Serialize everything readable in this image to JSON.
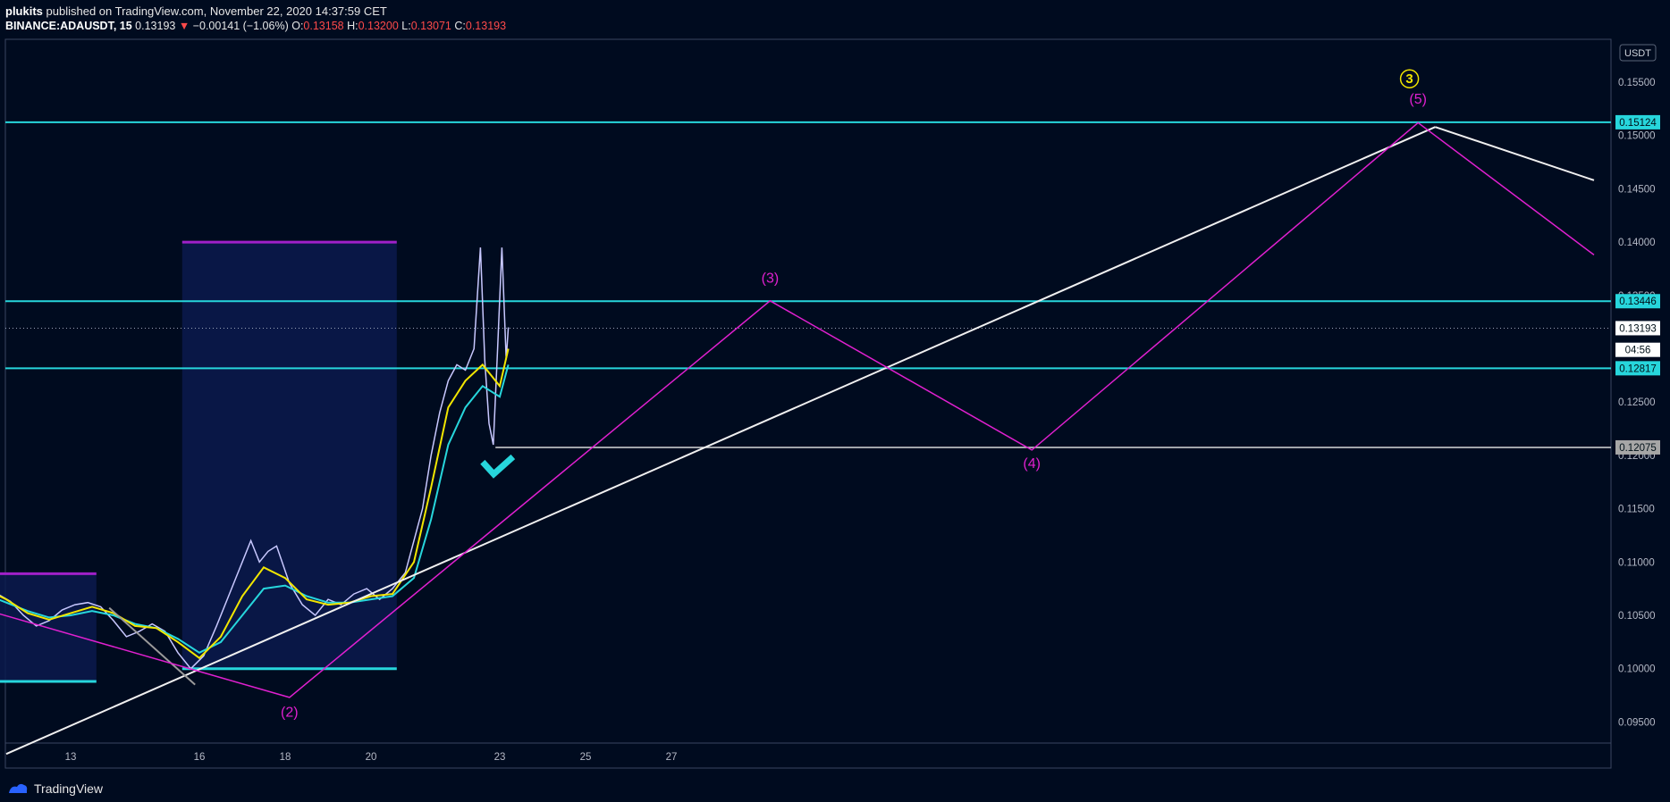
{
  "header": {
    "author": "plukits",
    "published": " published on TradingView.com, November 22, 2020 14:37:59 CET",
    "symbol": "BINANCE:ADAUSDT, 15",
    "last": "0.13193",
    "arrow": "▼",
    "change": "−0.00141 (−1.06%)",
    "o_label": "O:",
    "o_val": "0.13158",
    "h_label": "H:",
    "h_val": "0.13200",
    "l_label": "L:",
    "l_val": "0.13071",
    "c_label": "C:",
    "c_val": "0.13193"
  },
  "footer": {
    "brand": "TradingView"
  },
  "colors": {
    "background": "#000b1f",
    "cyan": "#27d6dc",
    "magenta": "#e020d0",
    "purple": "#a020c8",
    "white": "#f0f0f0",
    "yellow": "#f2e600",
    "candle": "#c8c8ff",
    "box": "#0a1a4d"
  },
  "chart_data": {
    "type": "line",
    "currency_label": "USDT",
    "x_ticks": [
      "13",
      "16",
      "18",
      "20",
      "23",
      "25",
      "27"
    ],
    "y_ticks": [
      "0.15500",
      "0.15000",
      "0.14500",
      "0.14000",
      "0.13500",
      "0.13000",
      "0.12500",
      "0.12000",
      "0.11500",
      "0.11000",
      "0.10500",
      "0.10000",
      "0.09500"
    ],
    "ylim": [
      0.0925,
      0.1588
    ],
    "price_labels": [
      {
        "text": "0.15124",
        "value": 0.15124,
        "style": "cyan"
      },
      {
        "text": "0.13446",
        "value": 0.13446,
        "style": "cyan"
      },
      {
        "text": "0.13193",
        "value": 0.13193,
        "style": "white"
      },
      {
        "text": "04:56",
        "value": 0.1299,
        "style": "white"
      },
      {
        "text": "0.12817",
        "value": 0.12817,
        "style": "cyan"
      },
      {
        "text": "0.12075",
        "value": 0.12075,
        "style": "gray"
      }
    ],
    "horizontal_levels": [
      {
        "value": 0.15124,
        "color": "cyan"
      },
      {
        "value": 0.13446,
        "color": "cyan"
      },
      {
        "value": 0.12817,
        "color": "cyan"
      },
      {
        "value": 0.13193,
        "color": "dotted"
      }
    ],
    "wave_path": [
      {
        "x": 9.3,
        "y": 0.1075
      },
      {
        "x": 18.1,
        "y": 0.0973
      },
      {
        "x": 29.3,
        "y": 0.1345
      },
      {
        "x": 35.4,
        "y": 0.1205
      },
      {
        "x": 44.4,
        "y": 0.1512
      },
      {
        "x": 48.5,
        "y": 0.1388
      }
    ],
    "wave_labels": [
      {
        "text": "(2)",
        "x": 18.1,
        "y": 0.0955
      },
      {
        "text": "(3)",
        "x": 29.3,
        "y": 0.1362
      },
      {
        "text": "(4)",
        "x": 35.4,
        "y": 0.1188
      },
      {
        "text": "(5)",
        "x": 44.4,
        "y": 0.153
      }
    ],
    "major_label": {
      "text": "3",
      "x": 44.2,
      "y": 0.1549
    },
    "trend_line": [
      {
        "x": 11.5,
        "y": 0.092
      },
      {
        "x": 44.8,
        "y": 0.1508
      }
    ],
    "trend_line_down": [
      {
        "x": 44.8,
        "y": 0.1508
      },
      {
        "x": 48.5,
        "y": 0.1458
      }
    ],
    "small_gray_line": [
      {
        "x": 13.9,
        "y": 0.1057
      },
      {
        "x": 15.9,
        "y": 0.0985
      }
    ],
    "support_line": {
      "value": 0.12075,
      "x_start": 22.9
    },
    "boxes": [
      {
        "x1": 11.0,
        "x2": 13.6,
        "top": 0.1089,
        "bottom": 0.0988
      },
      {
        "x1": 15.6,
        "x2": 20.6,
        "top": 0.14,
        "bottom": 0.1
      }
    ],
    "checkmark": {
      "x": 22.9,
      "y": 0.1185
    },
    "price": [
      [
        11.0,
        0.1085
      ],
      [
        11.3,
        0.107
      ],
      [
        11.6,
        0.1063
      ],
      [
        11.9,
        0.105
      ],
      [
        12.2,
        0.104
      ],
      [
        12.5,
        0.1045
      ],
      [
        12.8,
        0.1055
      ],
      [
        13.1,
        0.106
      ],
      [
        13.4,
        0.1062
      ],
      [
        13.7,
        0.1058
      ],
      [
        14.0,
        0.1045
      ],
      [
        14.3,
        0.103
      ],
      [
        14.6,
        0.1035
      ],
      [
        14.9,
        0.1042
      ],
      [
        15.2,
        0.1035
      ],
      [
        15.5,
        0.1015
      ],
      [
        15.8,
        0.1
      ],
      [
        16.1,
        0.1012
      ],
      [
        16.4,
        0.104
      ],
      [
        16.7,
        0.107
      ],
      [
        17.0,
        0.11
      ],
      [
        17.2,
        0.112
      ],
      [
        17.4,
        0.11
      ],
      [
        17.6,
        0.111
      ],
      [
        17.8,
        0.1115
      ],
      [
        18.1,
        0.108
      ],
      [
        18.4,
        0.106
      ],
      [
        18.7,
        0.105
      ],
      [
        19.0,
        0.1065
      ],
      [
        19.3,
        0.106
      ],
      [
        19.6,
        0.107
      ],
      [
        19.9,
        0.1075
      ],
      [
        20.2,
        0.1065
      ],
      [
        20.5,
        0.1075
      ],
      [
        20.8,
        0.109
      ],
      [
        21.0,
        0.112
      ],
      [
        21.2,
        0.115
      ],
      [
        21.4,
        0.12
      ],
      [
        21.6,
        0.124
      ],
      [
        21.8,
        0.127
      ],
      [
        22.0,
        0.1285
      ],
      [
        22.2,
        0.128
      ],
      [
        22.4,
        0.13
      ],
      [
        22.55,
        0.1395
      ],
      [
        22.65,
        0.129
      ],
      [
        22.75,
        0.123
      ],
      [
        22.85,
        0.121
      ],
      [
        22.95,
        0.13
      ],
      [
        23.05,
        0.1395
      ],
      [
        23.15,
        0.129
      ],
      [
        23.2,
        0.132
      ]
    ],
    "ema_yellow": [
      [
        11.0,
        0.1075
      ],
      [
        11.5,
        0.1065
      ],
      [
        12.0,
        0.1052
      ],
      [
        12.5,
        0.1046
      ],
      [
        13.0,
        0.1052
      ],
      [
        13.5,
        0.1058
      ],
      [
        14.0,
        0.1052
      ],
      [
        14.5,
        0.104
      ],
      [
        15.0,
        0.1038
      ],
      [
        15.5,
        0.1025
      ],
      [
        16.0,
        0.101
      ],
      [
        16.5,
        0.103
      ],
      [
        17.0,
        0.1068
      ],
      [
        17.5,
        0.1095
      ],
      [
        18.0,
        0.1085
      ],
      [
        18.5,
        0.1065
      ],
      [
        19.0,
        0.106
      ],
      [
        19.5,
        0.1062
      ],
      [
        20.0,
        0.1068
      ],
      [
        20.5,
        0.107
      ],
      [
        21.0,
        0.11
      ],
      [
        21.4,
        0.117
      ],
      [
        21.8,
        0.1245
      ],
      [
        22.2,
        0.127
      ],
      [
        22.6,
        0.1285
      ],
      [
        23.0,
        0.1265
      ],
      [
        23.2,
        0.13
      ]
    ],
    "ema_cyan": [
      [
        11.0,
        0.107
      ],
      [
        11.5,
        0.1062
      ],
      [
        12.0,
        0.1054
      ],
      [
        12.5,
        0.1048
      ],
      [
        13.0,
        0.105
      ],
      [
        13.5,
        0.1054
      ],
      [
        14.0,
        0.105
      ],
      [
        14.5,
        0.1042
      ],
      [
        15.0,
        0.1038
      ],
      [
        15.5,
        0.1028
      ],
      [
        16.0,
        0.1015
      ],
      [
        16.5,
        0.1025
      ],
      [
        17.0,
        0.105
      ],
      [
        17.5,
        0.1075
      ],
      [
        18.0,
        0.1078
      ],
      [
        18.5,
        0.1068
      ],
      [
        19.0,
        0.1062
      ],
      [
        19.5,
        0.1062
      ],
      [
        20.0,
        0.1065
      ],
      [
        20.5,
        0.1068
      ],
      [
        21.0,
        0.1085
      ],
      [
        21.4,
        0.114
      ],
      [
        21.8,
        0.121
      ],
      [
        22.2,
        0.1245
      ],
      [
        22.6,
        0.1265
      ],
      [
        23.0,
        0.1255
      ],
      [
        23.2,
        0.1285
      ]
    ]
  }
}
